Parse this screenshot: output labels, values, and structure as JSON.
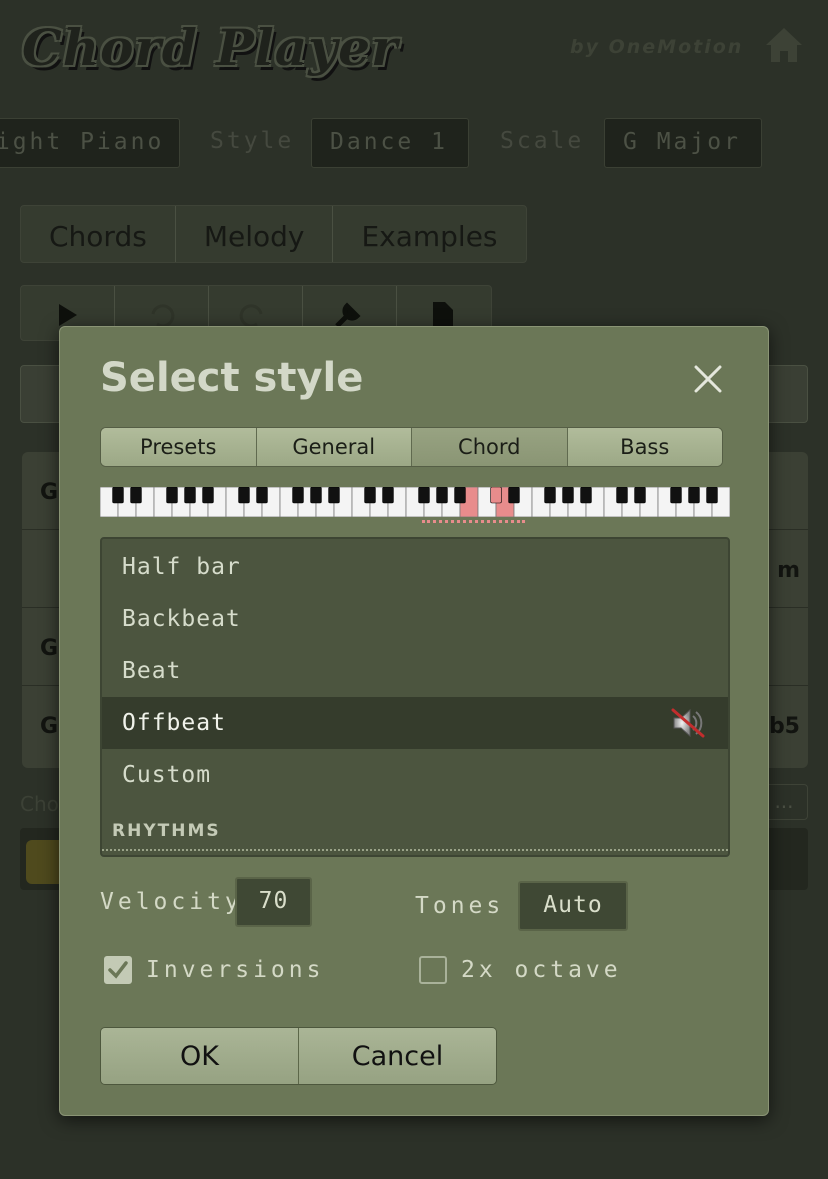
{
  "app": {
    "title": "Chord Player",
    "byline": "by OneMotion",
    "instrument_value": "Light Piano",
    "style_label": "Style",
    "style_value": "Dance 1",
    "scale_label": "Scale",
    "scale_value": "G Major",
    "tabs": [
      "Chords",
      "Melody",
      "Examples"
    ],
    "more_label": "...",
    "chord_prefix": "Cho",
    "grid_left": [
      "G",
      "",
      "G",
      "G"
    ],
    "grid_right": [
      "",
      "m",
      "",
      "b5"
    ]
  },
  "modal": {
    "title": "Select style",
    "tabs": [
      {
        "label": "Presets",
        "active": false
      },
      {
        "label": "General",
        "active": false
      },
      {
        "label": "Chord",
        "active": true
      },
      {
        "label": "Bass",
        "active": false
      }
    ],
    "list_items": [
      {
        "label": "Half bar",
        "selected": false
      },
      {
        "label": "Backbeat",
        "selected": false
      },
      {
        "label": "Beat",
        "selected": false
      },
      {
        "label": "Offbeat",
        "selected": true
      },
      {
        "label": "Custom",
        "selected": false
      }
    ],
    "section_label": "RHYTHMS",
    "velocity_label": "Velocity",
    "velocity_value": "70",
    "tones_label": "Tones",
    "tones_value": "Auto",
    "inversions_label": "Inversions",
    "inversions_checked": true,
    "octave_label": "2x octave",
    "octave_checked": false,
    "ok_label": "OK",
    "cancel_label": "Cancel"
  },
  "colors": {
    "modal_bg": "#6b7757",
    "highlight_key": "#e88c8c",
    "list_bg": "#4c553f"
  },
  "icons": [
    "home-icon",
    "play-icon",
    "undo-icon",
    "redo-icon",
    "wrench-icon",
    "document-icon",
    "close-icon",
    "speaker-icon"
  ]
}
